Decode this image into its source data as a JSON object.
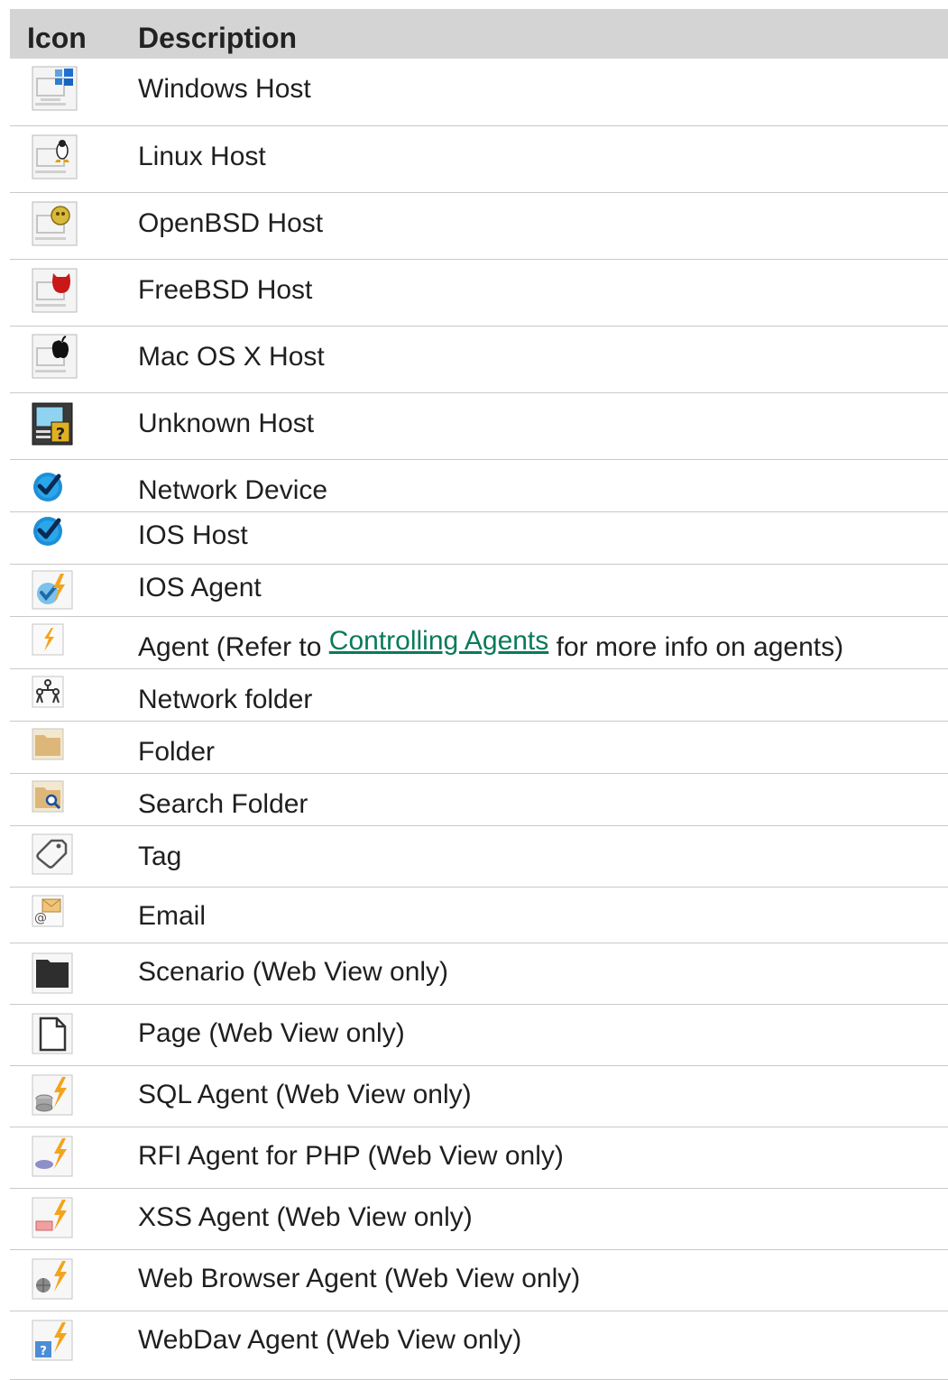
{
  "table": {
    "headers": {
      "icon": "Icon",
      "description": "Description"
    },
    "rows": [
      {
        "icon": "windows-host-icon",
        "description": "Windows Host"
      },
      {
        "icon": "linux-host-icon",
        "description": "Linux Host"
      },
      {
        "icon": "openbsd-host-icon",
        "description": "OpenBSD Host"
      },
      {
        "icon": "freebsd-host-icon",
        "description": "FreeBSD Host"
      },
      {
        "icon": "macosx-host-icon",
        "description": "Mac OS X Host"
      },
      {
        "icon": "unknown-host-icon",
        "description": "Unknown Host"
      },
      {
        "icon": "network-device-icon",
        "description": "Network Device"
      },
      {
        "icon": "ios-host-icon",
        "description": "IOS Host"
      },
      {
        "icon": "ios-agent-icon",
        "description": "IOS Agent"
      },
      {
        "icon": "agent-icon",
        "description_before": "Agent (Refer to ",
        "link": "Controlling Agents",
        "description_after": " for more info on agents)"
      },
      {
        "icon": "network-folder-icon",
        "description": "Network folder"
      },
      {
        "icon": "folder-icon",
        "description": "Folder"
      },
      {
        "icon": "search-folder-icon",
        "description": "Search Folder"
      },
      {
        "icon": "tag-icon",
        "description": "Tag"
      },
      {
        "icon": "email-icon",
        "description": "Email"
      },
      {
        "icon": "scenario-icon",
        "description": "Scenario (Web View only)"
      },
      {
        "icon": "page-icon",
        "description": "Page (Web View only)"
      },
      {
        "icon": "sql-agent-icon",
        "description": "SQL Agent (Web View only)"
      },
      {
        "icon": "rfi-agent-icon",
        "description": "RFI Agent for PHP (Web View only)"
      },
      {
        "icon": "xss-agent-icon",
        "description": "XSS Agent (Web View only)"
      },
      {
        "icon": "web-browser-agent-icon",
        "description": "Web Browser Agent (Web View only)"
      },
      {
        "icon": "webdav-agent-icon",
        "description": "WebDav Agent (Web View only)"
      }
    ]
  }
}
